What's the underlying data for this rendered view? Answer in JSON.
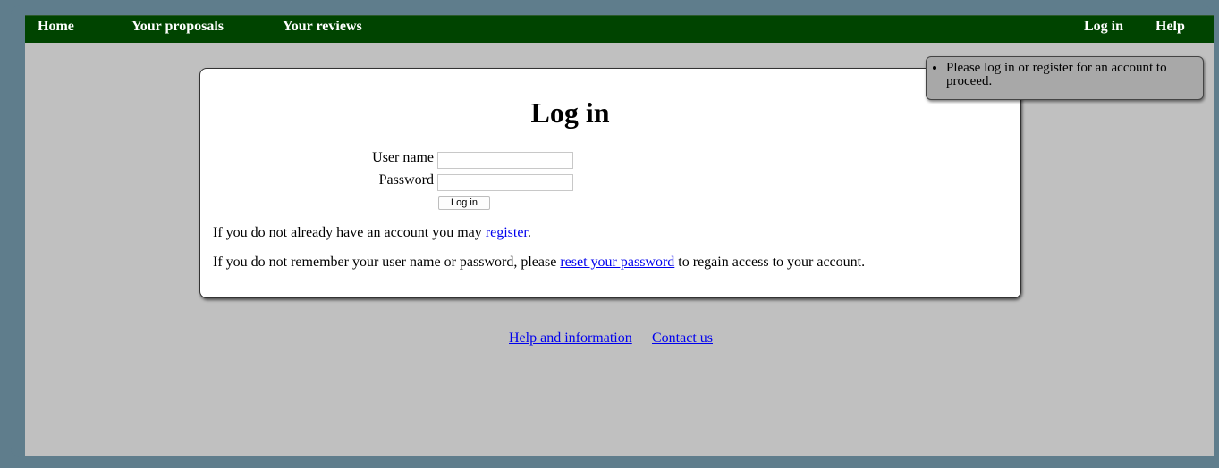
{
  "nav": {
    "home": "Home",
    "proposals": "Your proposals",
    "reviews": "Your reviews",
    "login": "Log in",
    "help": "Help"
  },
  "login_panel": {
    "title": "Log in",
    "username_label": "User name",
    "password_label": "Password",
    "username_value": "",
    "password_value": "",
    "submit_label": "Log in",
    "register_text_before": "If you do not already have an account you may ",
    "register_link": "register",
    "register_text_after": ".",
    "reset_text_before": "If you do not remember your user name or password, please ",
    "reset_link": "reset your password",
    "reset_text_after": " to regain access to your account."
  },
  "footer": {
    "help_link": "Help and information",
    "contact_link": "Contact us"
  },
  "notice": {
    "message": "Please log in or register for an account to proceed."
  },
  "colors": {
    "nav_bg": "#004400",
    "page_bg": "#c0c0c0",
    "frame_bg": "#5f7d8c",
    "link": "#0000ee",
    "notice_bg": "#a8a8a8"
  }
}
